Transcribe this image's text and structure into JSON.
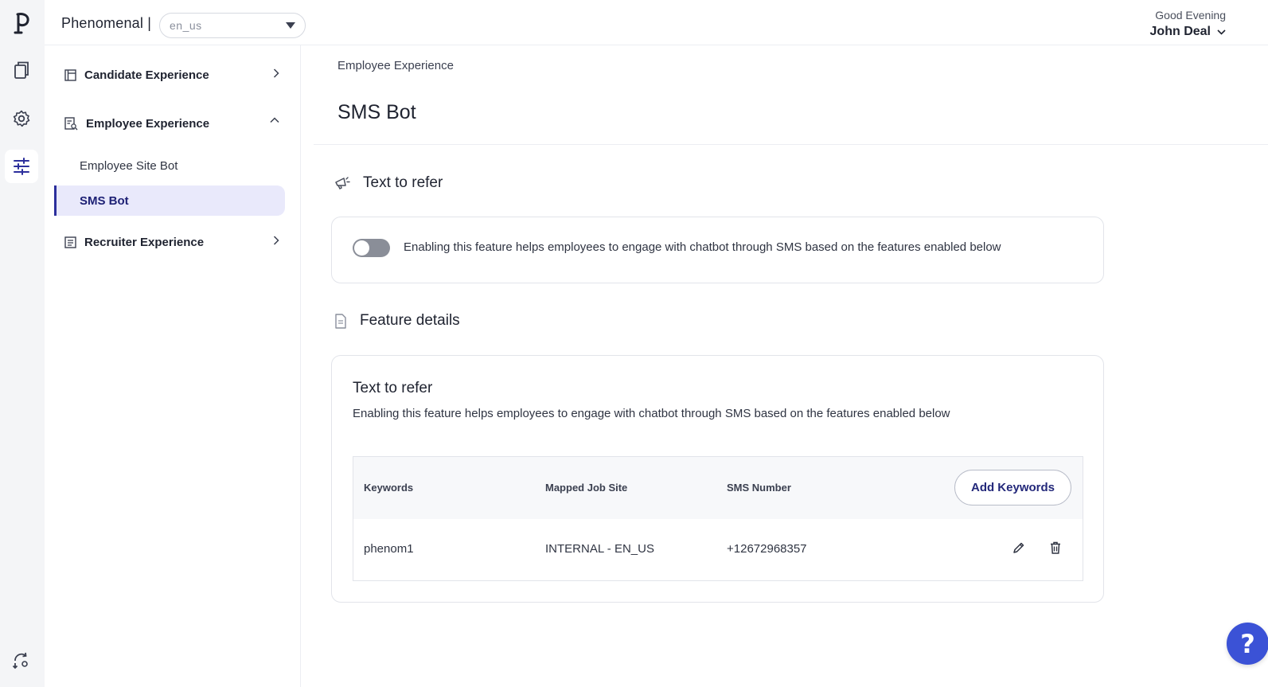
{
  "app": {
    "brand": "Phenomenal |",
    "language": {
      "selected": "en_us"
    }
  },
  "header": {
    "greeting": "Good Evening",
    "user_name": "John Deal"
  },
  "rail": {
    "icons": [
      "phenom-logo-icon",
      "documents-icon",
      "gear-icon",
      "sliders-icon",
      "sync-settings-icon"
    ]
  },
  "sidebar": {
    "groups": [
      {
        "label": "Candidate Experience",
        "expanded": false
      },
      {
        "label": "Employee Experience",
        "expanded": true,
        "items": [
          {
            "label": "Employee Site Bot",
            "active": false
          },
          {
            "label": "SMS Bot",
            "active": true
          }
        ]
      },
      {
        "label": "Recruiter Experience",
        "expanded": false
      }
    ]
  },
  "main": {
    "breadcrumb": "Employee Experience",
    "title": "SMS Bot",
    "text_to_refer": {
      "heading": "Text to refer",
      "toggle_enabled": false,
      "toggle_description": "Enabling this feature helps employees to engage with chatbot through SMS based on the features enabled below"
    },
    "feature_details": {
      "heading": "Feature details",
      "card_title": "Text to refer",
      "card_description": "Enabling this feature helps employees to engage with chatbot through SMS based on the features enabled below",
      "table": {
        "columns": [
          "Keywords",
          "Mapped Job Site",
          "SMS Number"
        ],
        "add_button": "Add Keywords",
        "rows": [
          {
            "keyword": "phenom1",
            "job_site": "INTERNAL - EN_US",
            "sms_number": "+12672968357"
          }
        ]
      }
    },
    "help_label": "?"
  },
  "colors": {
    "accent": "#2c2f9c",
    "active_bg": "#e9e9fb",
    "help_button": "#3b52d6",
    "toggle_off": "#8a8e98"
  }
}
